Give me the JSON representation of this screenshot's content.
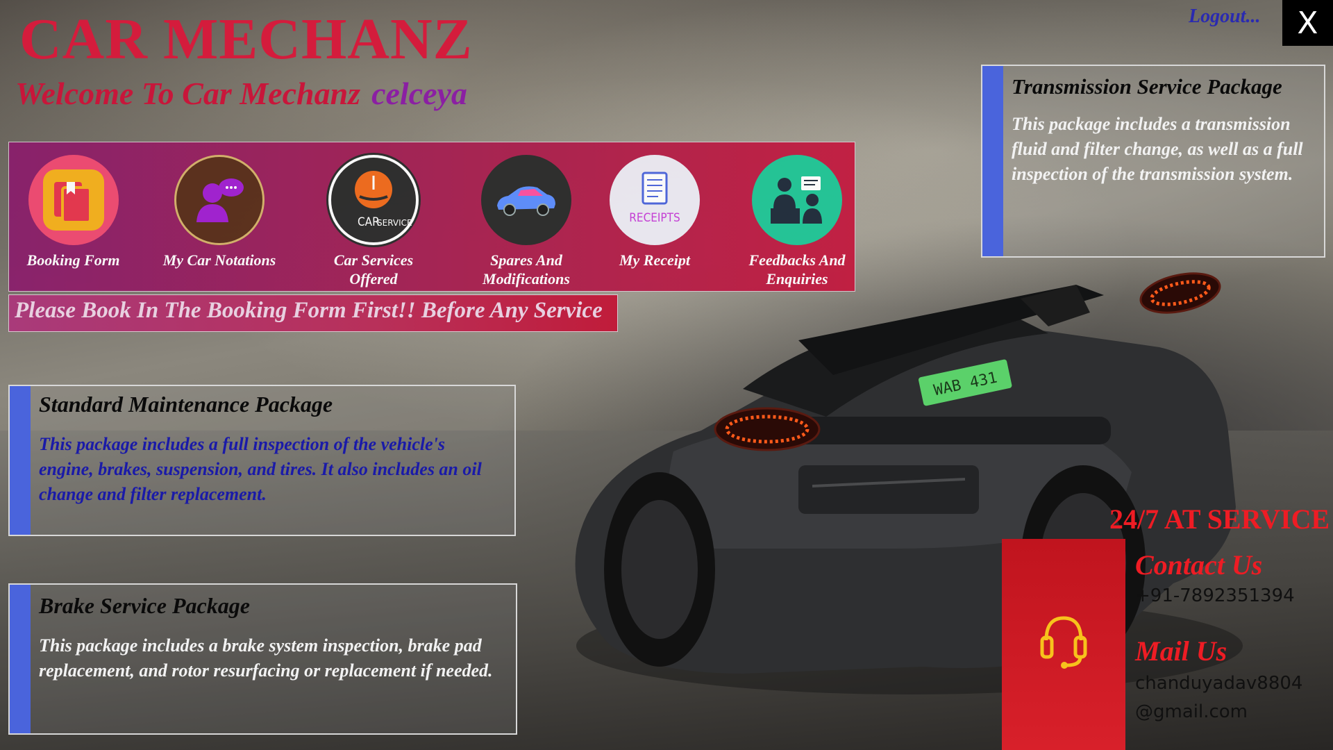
{
  "app": {
    "brand": "CAR MECHANZ",
    "welcome_text": "Welcome To Car Mechanz",
    "username": "celceya",
    "logout_label": "Logout...",
    "close_label": "X"
  },
  "menu": {
    "items": [
      {
        "label": "Booking Form",
        "icon": "booking-form-icon",
        "color": "#f4a017"
      },
      {
        "label": "My Car Notations",
        "icon": "car-notations-icon",
        "color": "#5a2e1a"
      },
      {
        "label": "Car Services\nOffered",
        "icon": "car-service-icon",
        "color": "#2b2b2b",
        "icon_text_1": "CAR",
        "icon_text_2": "SERVICE"
      },
      {
        "label": "Spares And\nModifications",
        "icon": "spares-car-icon",
        "color": "#2a2a2a"
      },
      {
        "label": "My Receipt",
        "icon": "receipts-icon",
        "color": "#eceaf3",
        "icon_text": "RECEIPTS"
      },
      {
        "label": "Feedbacks And\nEnquiries",
        "icon": "feedback-enquiries-icon",
        "color": "#1fc596"
      }
    ]
  },
  "notice": "Please Book In The Booking Form First!! Before Any Service",
  "packages": {
    "transmission": {
      "title": "Transmission Service Package",
      "description": "This package includes a transmission fluid and filter change, as well as a full inspection of the transmission system."
    },
    "standard": {
      "title": "Standard Maintenance Package",
      "description": "This package includes a full inspection of the vehicle's engine, brakes, suspension, and tires. It also includes an oil change and filter replacement."
    },
    "brake": {
      "title": "Brake Service Package",
      "description": "This package includes a brake system inspection, brake pad replacement, and rotor resurfacing or replacement if needed."
    }
  },
  "contact": {
    "availability": "24/7 AT SERVICE",
    "contact_heading": "Contact Us",
    "phone": "+91-7892351394",
    "mail_heading": "Mail Us",
    "email": "chanduyadav8804@gmail.com",
    "icon": "headset-icon"
  },
  "car": {
    "plate": "WAB 431"
  },
  "colors": {
    "brand_red": "#d41c3c",
    "username_purple": "#8b1fa3",
    "accent_blue": "#4a64dc",
    "contact_red": "#ee1c24"
  }
}
